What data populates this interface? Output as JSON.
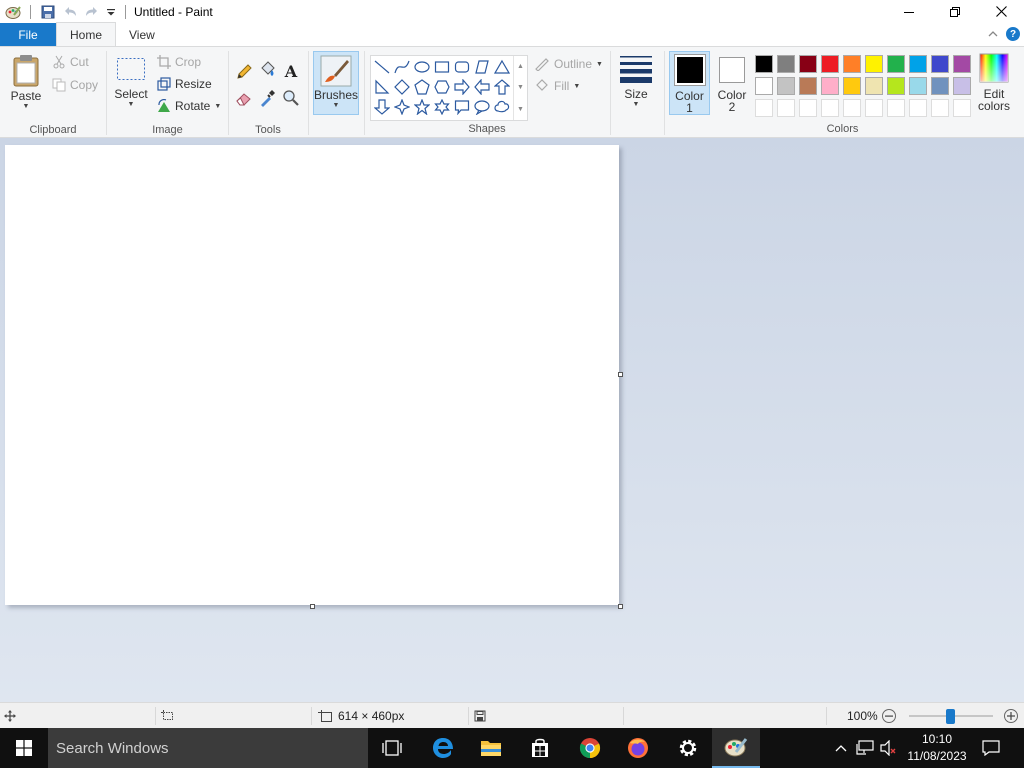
{
  "window": {
    "title": "Untitled - Paint",
    "minimize_glyph": "—",
    "restore_glyph": "❐",
    "close_glyph": "✕"
  },
  "tabs": {
    "file": "File",
    "home": "Home",
    "view": "View",
    "help": "?"
  },
  "clipboard": {
    "paste": "Paste",
    "cut": "Cut",
    "copy": "Copy",
    "label": "Clipboard"
  },
  "image": {
    "select": "Select",
    "crop": "Crop",
    "resize": "Resize",
    "rotate": "Rotate",
    "label": "Image"
  },
  "tools": {
    "label": "Tools",
    "text_glyph": "A"
  },
  "brushes": {
    "label": "Brushes"
  },
  "shapes": {
    "outline": "Outline",
    "fill": "Fill",
    "label": "Shapes"
  },
  "size": {
    "label": "Size"
  },
  "colors": {
    "color1_line1": "Color",
    "color1_line2": "1",
    "color2_line1": "Color",
    "color2_line2": "2",
    "edit_line1": "Edit",
    "edit_line2": "colors",
    "label": "Colors",
    "color1_value": "#000000",
    "color2_value": "#ffffff",
    "palette": [
      "#000000",
      "#7f7f7f",
      "#880015",
      "#ed1c24",
      "#ff7f27",
      "#fff200",
      "#22b14c",
      "#00a2e8",
      "#3f48cc",
      "#a349a4",
      "#ffffff",
      "#c3c3c3",
      "#b97a57",
      "#ffaec9",
      "#ffc90e",
      "#efe4b0",
      "#b5e61d",
      "#99d9ea",
      "#7092be",
      "#c8bfe7",
      "",
      "",
      "",
      "",
      "",
      "",
      "",
      "",
      "",
      ""
    ]
  },
  "status": {
    "canvas_size": "614 × 460px",
    "zoom": "100%",
    "zoom_level_percent": 100
  },
  "taskbar": {
    "search_placeholder": "Search Windows",
    "time": "10:10",
    "date": "11/08/2023"
  }
}
